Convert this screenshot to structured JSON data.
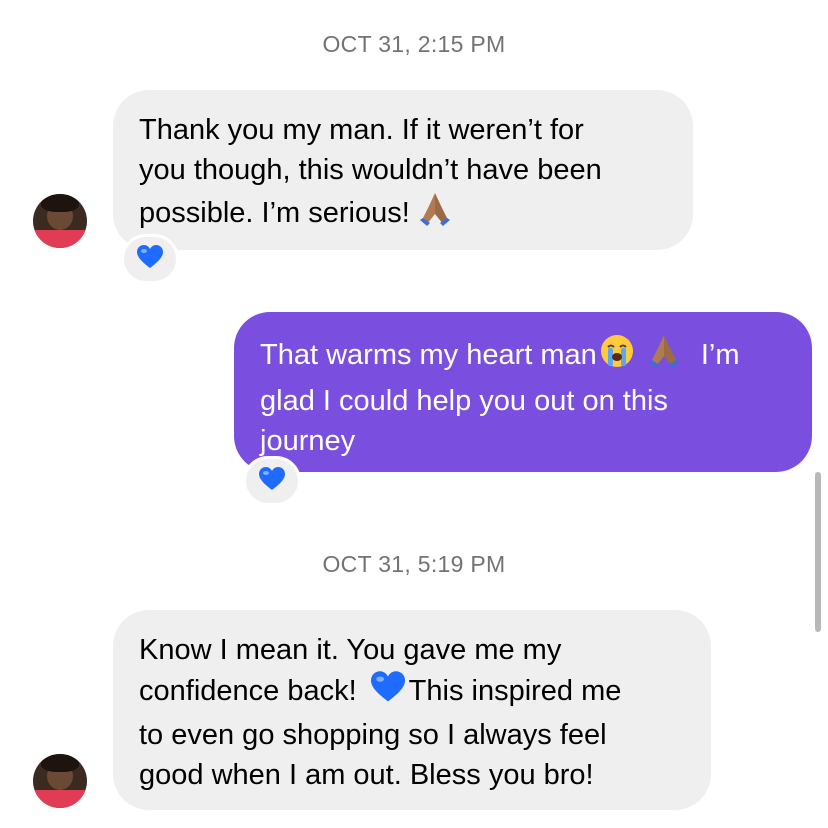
{
  "timestamps": [
    "OCT 31, 2:15 PM",
    "OCT 31, 5:19 PM"
  ],
  "messages": [
    {
      "sender": "incoming",
      "lines": [
        "Thank you my man. If it weren’t for",
        "you though, this wouldn’t have been",
        "possible. I’m serious!"
      ],
      "trailing_emoji": "folded-hands-icon",
      "reaction": "blue-heart-icon"
    },
    {
      "sender": "outgoing",
      "lines": [
        "That warms my heart man",
        "I’m",
        "glad I could help you out on this",
        "journey"
      ],
      "inline_emojis": [
        "loudly-crying-face-icon",
        "folded-hands-icon"
      ],
      "reaction": "blue-heart-icon"
    },
    {
      "sender": "incoming",
      "lines": [
        "Know I mean it. You gave me my",
        "confidence back!",
        "This inspired me",
        "to even go shopping so I always feel",
        "good when I am out. Bless you bro!"
      ],
      "inline_emojis": [
        "blue-heart-icon"
      ]
    }
  ],
  "colors": {
    "incoming_bubble": "#efefef",
    "outgoing_bubble": "#7a4fe0",
    "timestamp": "#737373",
    "heart": "#1f6bff"
  }
}
